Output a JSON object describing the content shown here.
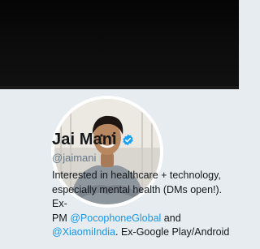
{
  "profile": {
    "name": "Jai Mani",
    "handle": "@jaimani",
    "verified": true,
    "verified_icon": "verified-badge-icon",
    "accent_color": "#1da1f2",
    "link_color": "#1b95e0",
    "bio": {
      "line1": "Interested in healthcare + technology,",
      "line2": "especially mental health (DMs open!). Ex-",
      "line3_prefix": "PM ",
      "link1": "@PocophoneGlobal",
      "line3_suffix": " and",
      "link2": "@XiaomiIndia",
      "line4_suffix": ". Ex-Google Play/Android"
    }
  }
}
